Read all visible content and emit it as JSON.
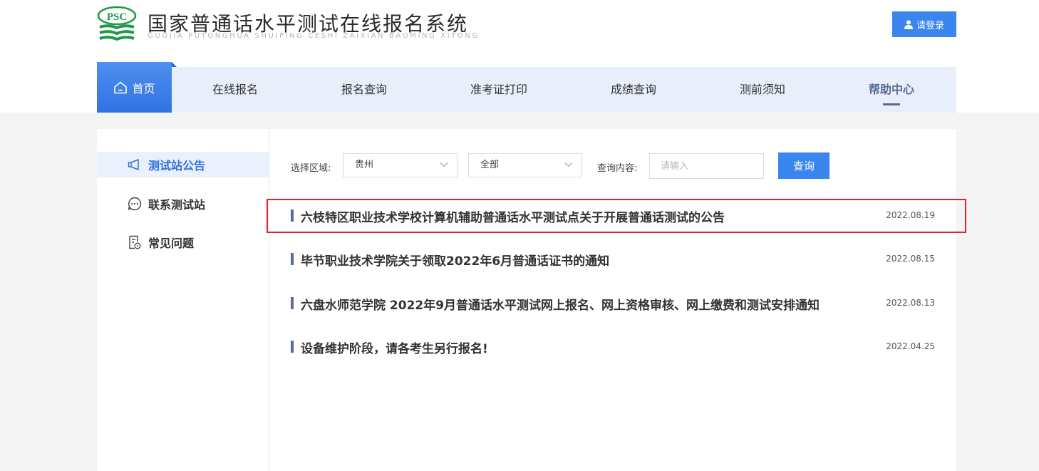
{
  "header": {
    "logo_text": "PSC",
    "site_title": "国家普通话水平测试在线报名系统",
    "site_subtitle": "GUOJIA PUTONGHUA SHUIPING CESHI ZAIXIAN BAOMING XITONG",
    "login_label": "请登录"
  },
  "nav": {
    "home_label": "首页",
    "items": [
      {
        "label": "在线报名"
      },
      {
        "label": "报名查询"
      },
      {
        "label": "准考证打印"
      },
      {
        "label": "成绩查询"
      },
      {
        "label": "测前须知"
      },
      {
        "label": "帮助中心"
      }
    ],
    "active": "帮助中心"
  },
  "sidebar": {
    "items": [
      {
        "label": "测试站公告",
        "icon": "megaphone-icon"
      },
      {
        "label": "联系测试站",
        "icon": "chat-bubble-icon"
      },
      {
        "label": "常见问题",
        "icon": "document-question-icon"
      }
    ]
  },
  "filters": {
    "region_label": "选择区域:",
    "region_value": "贵州",
    "category_value": "全部",
    "query_label": "查询内容:",
    "query_placeholder": "请输入",
    "search_button": "查询"
  },
  "notices": [
    {
      "title": "六枝特区职业技术学校计算机辅助普通话水平测试点关于开展普通话测试的公告",
      "date": "2022.08.19"
    },
    {
      "title": "毕节职业技术学院关于领取2022年6月普通话证书的通知",
      "date": "2022.08.15"
    },
    {
      "title": "六盘水师范学院 2022年9月普通话水平测试网上报名、网上资格审核、网上缴费和测试安排通知",
      "date": "2022.08.13"
    },
    {
      "title": "设备维护阶段，请各考生另行报名!",
      "date": "2022.04.25"
    }
  ],
  "colors": {
    "accent": "#3a86ee",
    "nav_bg": "#e9effa",
    "highlight_border": "#e0232b",
    "logo_green": "#1e9a48"
  }
}
